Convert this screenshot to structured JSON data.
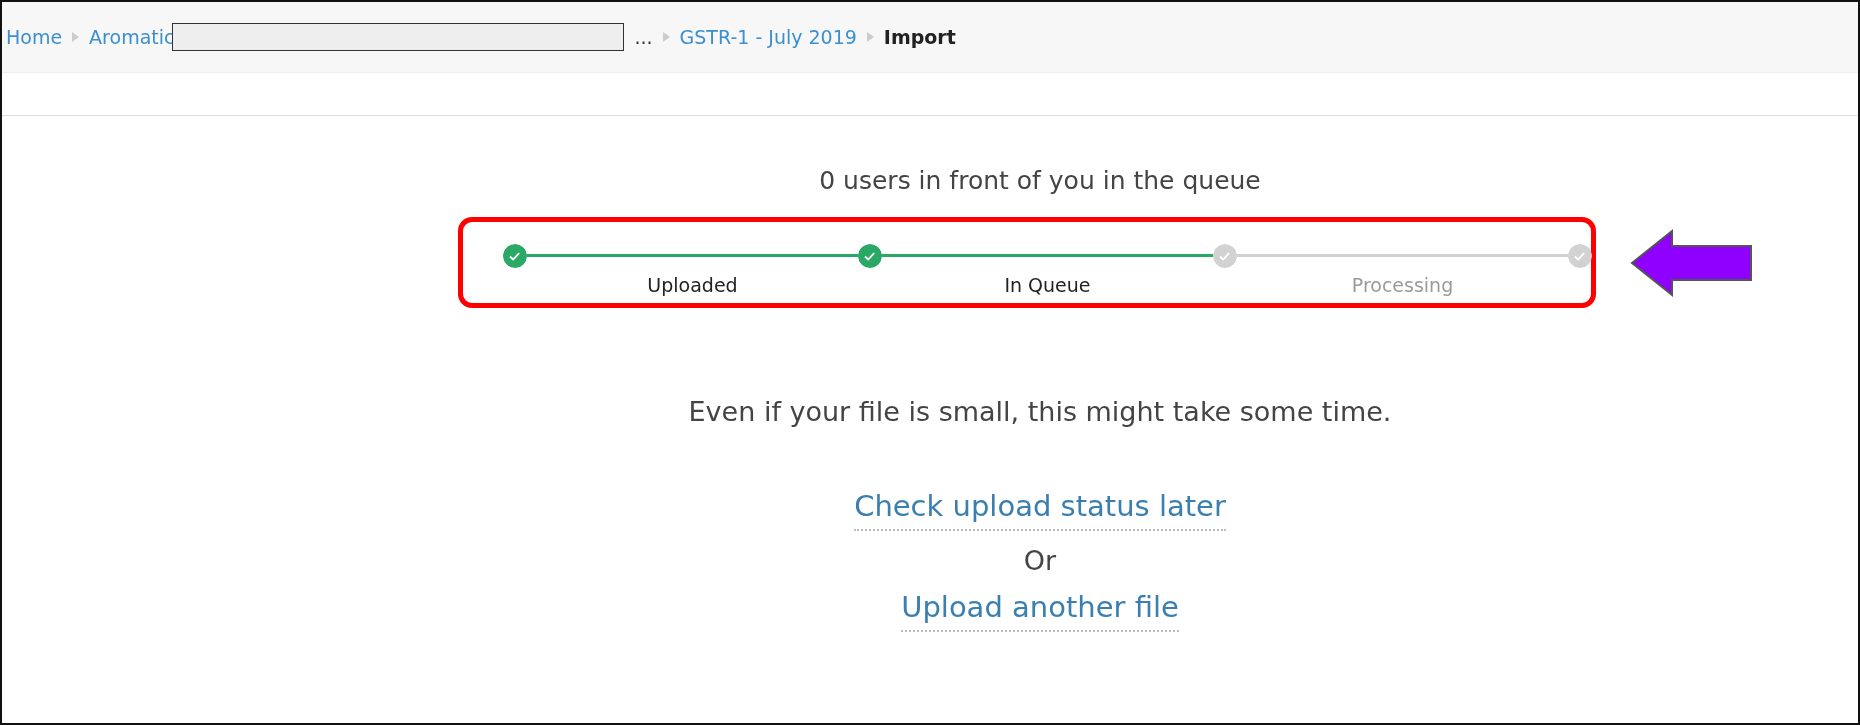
{
  "breadcrumb": [
    {
      "label": "Home",
      "kind": "link"
    },
    {
      "label": "Aromatic",
      "kind": "redacted"
    },
    {
      "label": "...",
      "kind": "text"
    },
    {
      "label": "GSTR-1 - July 2019",
      "kind": "link"
    },
    {
      "label": "Import",
      "kind": "current"
    }
  ],
  "queue_message": "0 users in front of you in the queue",
  "progress": {
    "highlighted": true,
    "nodes": [
      {
        "done": true
      },
      {
        "done": true
      },
      {
        "done": false
      },
      {
        "done": false
      }
    ],
    "steps": [
      {
        "label": "Uploaded",
        "done": true
      },
      {
        "label": "In Queue",
        "done": true
      },
      {
        "label": "Processing",
        "done": false
      }
    ]
  },
  "annotation_arrow": true,
  "notice": "Even if your file is small, this might take some time.",
  "check_status_link": "Check upload status later",
  "separator": "Or",
  "upload_link": "Upload another file"
}
